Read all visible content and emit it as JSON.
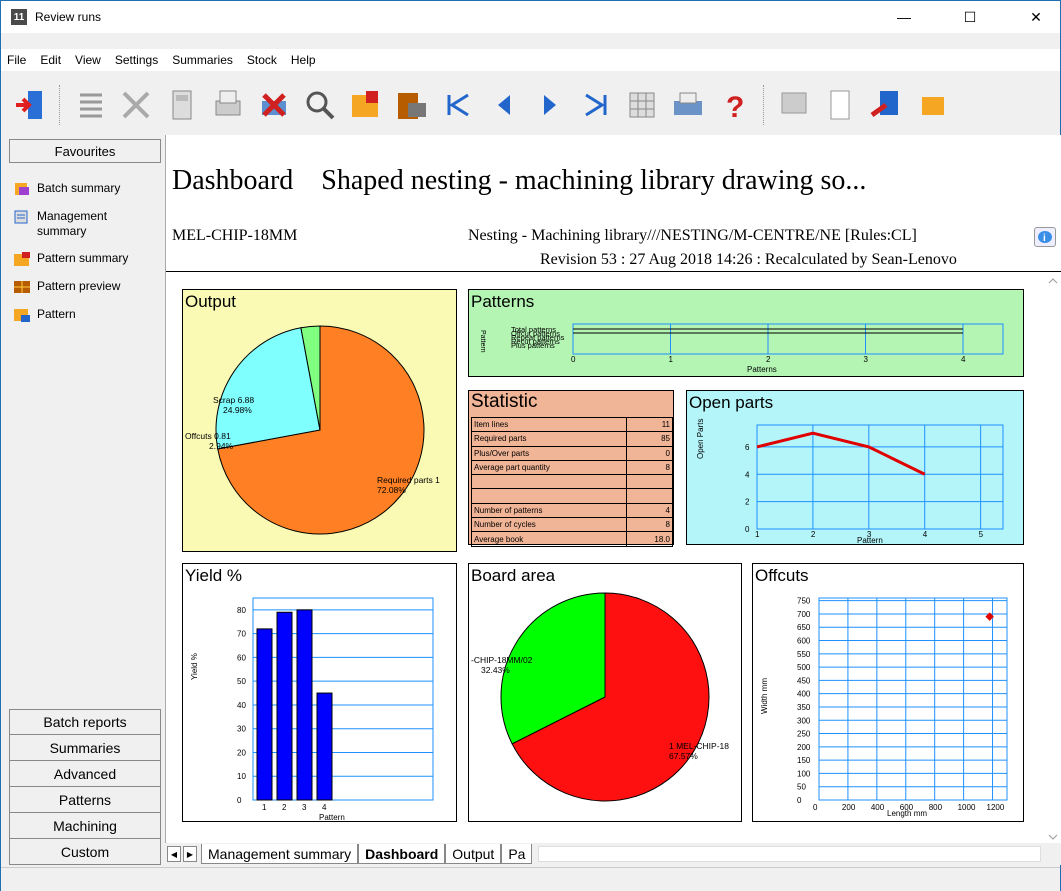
{
  "window": {
    "title": "Review runs",
    "app_icon": "11"
  },
  "menu": [
    "File",
    "Edit",
    "View",
    "Settings",
    "Summaries",
    "Stock",
    "Help"
  ],
  "toolbar_icons": [
    "exit-icon",
    "list-icon",
    "delete-icon",
    "calculator-icon",
    "print-preview-icon",
    "cancel-icon",
    "search-icon",
    "pattern-icon",
    "edit-pattern-icon",
    "first-icon",
    "previous-icon",
    "next-icon",
    "last-icon",
    "table-icon",
    "printer-icon",
    "help-icon",
    "report-icon",
    "page-icon",
    "export-icon",
    "output-icon"
  ],
  "sidebar": {
    "header": "Favourites",
    "items": [
      "Batch summary",
      "Management summary",
      "Pattern summary",
      "Pattern preview",
      "Pattern"
    ],
    "bottom": [
      "Batch reports",
      "Summaries",
      "Advanced",
      "Patterns",
      "Machining",
      "Custom"
    ]
  },
  "dashboard": {
    "title": "Dashboard",
    "subtitle": "Shaped nesting - machining library drawing so...",
    "board": "MEL-CHIP-18MM",
    "library": "Nesting - Machining library///NESTING/M-CENTRE/NE [Rules:CL]",
    "revision": "Revision 53 : 27 Aug 2018 14:26 : Recalculated by Sean-Lenovo"
  },
  "panels": {
    "output": "Output",
    "patterns": "Patterns",
    "statistic": "Statistic",
    "open_parts": "Open parts",
    "yield": "Yield %",
    "board_area": "Board area",
    "offcuts": "Offcuts"
  },
  "statistic_rows": [
    {
      "label": "Item lines",
      "value": "11"
    },
    {
      "label": "Required parts",
      "value": "85"
    },
    {
      "label": "Plus/Over parts",
      "value": "0"
    },
    {
      "label": "Average part quantity",
      "value": "8"
    },
    {
      "label": "",
      "value": ""
    },
    {
      "label": "",
      "value": ""
    },
    {
      "label": "Number of patterns",
      "value": "4"
    },
    {
      "label": "Number of cycles",
      "value": "8"
    },
    {
      "label": "Average book",
      "value": "18.0"
    }
  ],
  "tabs": [
    "Management summary",
    "Dashboard",
    "Output",
    "Pa"
  ],
  "colors": {
    "orange": "#ff8024",
    "cyan": "#80ffff",
    "green_light": "#80ff80",
    "yellow_bg": "#fafab4",
    "green_bg": "#b4f5b4",
    "salmon_bg": "#f0b496",
    "cyan_bg": "#b4f5fa",
    "blue": "#0000ff",
    "red": "#ff0000",
    "green": "#00ff00"
  },
  "chart_data": [
    {
      "type": "pie",
      "title": "Output",
      "labels": [
        "Required parts 1",
        "Scrap 6.88",
        "Offcuts 0.81"
      ],
      "values": [
        72.08,
        24.98,
        2.94
      ],
      "label_pcts": [
        "72.08%",
        "24.98%",
        "2.94%"
      ]
    },
    {
      "type": "bar",
      "title": "Patterns",
      "categories": [
        "Total patterns",
        "Offcut patterns",
        "Repeat patterns",
        "Recut patterns",
        "Plus patterns"
      ],
      "xlabel": "Patterns",
      "ylabel": "Pattern",
      "xlim": [
        0,
        4
      ],
      "values": [
        4,
        4,
        0,
        0,
        0
      ],
      "x_ticks": [
        "0",
        "1",
        "2",
        "3",
        "4"
      ]
    },
    {
      "type": "line",
      "title": "Open parts",
      "x": [
        1,
        2,
        3,
        4
      ],
      "y": [
        6,
        7,
        6,
        4
      ],
      "xlabel": "Pattern",
      "ylabel": "Open Parts",
      "x_ticks": [
        "1",
        "2",
        "3",
        "4",
        "5"
      ],
      "y_ticks": [
        "0",
        "2",
        "4",
        "6"
      ]
    },
    {
      "type": "bar",
      "title": "Yield %",
      "categories": [
        "1",
        "2",
        "3",
        "4"
      ],
      "values": [
        72,
        79,
        80,
        45
      ],
      "xlabel": "Pattern",
      "ylabel": "Yield %",
      "y_ticks": [
        "0",
        "10",
        "20",
        "30",
        "40",
        "50",
        "60",
        "70",
        "80"
      ]
    },
    {
      "type": "pie",
      "title": "Board area",
      "labels": [
        "1 MEL-CHIP-18",
        "-CHIP-18MM/02"
      ],
      "values": [
        67.57,
        32.43
      ],
      "label_pcts": [
        "67.57%",
        "32.43%"
      ]
    },
    {
      "type": "scatter",
      "title": "Offcuts",
      "x": [
        1180
      ],
      "y": [
        690
      ],
      "xlabel": "Length mm",
      "ylabel": "Width mm",
      "x_ticks": [
        "0",
        "200",
        "400",
        "600",
        "800",
        "1000",
        "1200"
      ],
      "y_ticks": [
        "0",
        "50",
        "100",
        "150",
        "200",
        "250",
        "300",
        "350",
        "400",
        "450",
        "500",
        "550",
        "600",
        "650",
        "700",
        "750"
      ]
    }
  ]
}
